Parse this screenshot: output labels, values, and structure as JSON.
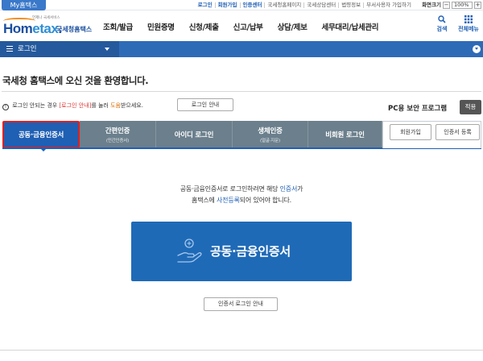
{
  "top_bar": {
    "my_tab": "My홈택스",
    "links": [
      "로그인",
      "회원가입",
      "인증센터",
      "국세청홈페이지",
      "국세상담센터",
      "법령정보",
      "부서사용자 가입하기"
    ],
    "zoom_label": "화면크기",
    "zoom_minus": "−",
    "zoom_value": "100%",
    "zoom_plus": "+"
  },
  "header": {
    "logo_tagline": "언제나 국세서비스",
    "logo_text_main": "Hom",
    "logo_text_accent": "etax",
    "logo_text_dot": ".",
    "logo_kor": "국세청홈택스",
    "menu": [
      "조회/발급",
      "민원증명",
      "신청/제출",
      "신고/납부",
      "상담/제보",
      "세무대리/납세관리"
    ],
    "search_label": "검색",
    "all_menu_label": "전체메뉴"
  },
  "nav": {
    "current": "로그인"
  },
  "welcome": {
    "title": "국세청 홈택스에 오신 것을 환영합니다.",
    "notice_ex": "!",
    "notice_prefix": " 로그인 안되는 경우 ",
    "notice_red": "[로그인 안내]",
    "notice_mid": "를 눌러 ",
    "notice_org": "도움",
    "notice_suffix": "받으세요.",
    "guide_button": "로그인 안내",
    "pc_security_label": "PC용 보안 프로그램",
    "apply_button": "적용"
  },
  "tabs": [
    {
      "label": "공동·금융인증서",
      "sub": ""
    },
    {
      "label": "간편인증",
      "sub": "(민간인증서)"
    },
    {
      "label": "아이디 로그인",
      "sub": ""
    },
    {
      "label": "생체인증",
      "sub": "(얼굴·지문)"
    },
    {
      "label": "비회원 로그인",
      "sub": ""
    }
  ],
  "side_buttons": {
    "join": "회원가입",
    "cert_register": "인증서 등록"
  },
  "main": {
    "desc_line1_a": "공동·금융인증서로 로그인하려면 해당 ",
    "desc_line1_b": "인증서",
    "desc_line1_c": "가",
    "desc_line2_a": "홈택스에 ",
    "desc_line2_b": "사전등록",
    "desc_line2_c": "되어 있어야 합니다.",
    "big_button": "공동·금융인증서",
    "cert_login_guide": "인증서 로그인 안내"
  },
  "colors": {
    "primary_blue": "#1f5fb4",
    "nav_blue": "#2e6bb7",
    "tab_gray": "#6b7f8c",
    "highlight_red": "#e02020"
  }
}
